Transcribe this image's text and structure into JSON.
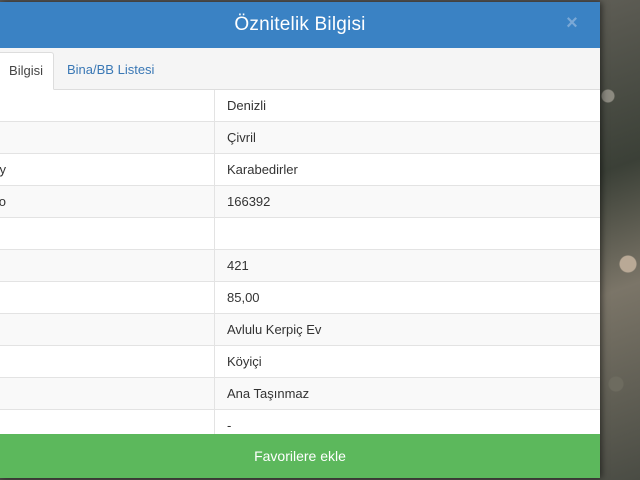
{
  "modal": {
    "title": "Öznitelik Bilgisi",
    "close_symbol": "×"
  },
  "tabs": [
    {
      "label": "Bilgisi",
      "active": true
    },
    {
      "label": "Bina/BB Listesi",
      "active": false
    }
  ],
  "rows": [
    {
      "label": "",
      "value": "Denizli"
    },
    {
      "label": "",
      "value": "Çivril"
    },
    {
      "label": "öy",
      "value": "Karabedirler"
    },
    {
      "label": "o",
      "value": "166392"
    },
    {
      "label": "",
      "value": ""
    },
    {
      "label": "",
      "value": "421"
    },
    {
      "label": "",
      "value": "85,00"
    },
    {
      "label": "",
      "value": "Avlulu Kerpiç Ev"
    },
    {
      "label": "",
      "value": "Köyiçi"
    },
    {
      "label": "",
      "value": "Ana Taşınmaz"
    },
    {
      "label": "",
      "value": "-"
    }
  ],
  "footer": {
    "favorite_label": "Favorilere ekle"
  },
  "colors": {
    "header": "#3a82c4",
    "button": "#5cb85c",
    "tab_link": "#3a78b5"
  }
}
